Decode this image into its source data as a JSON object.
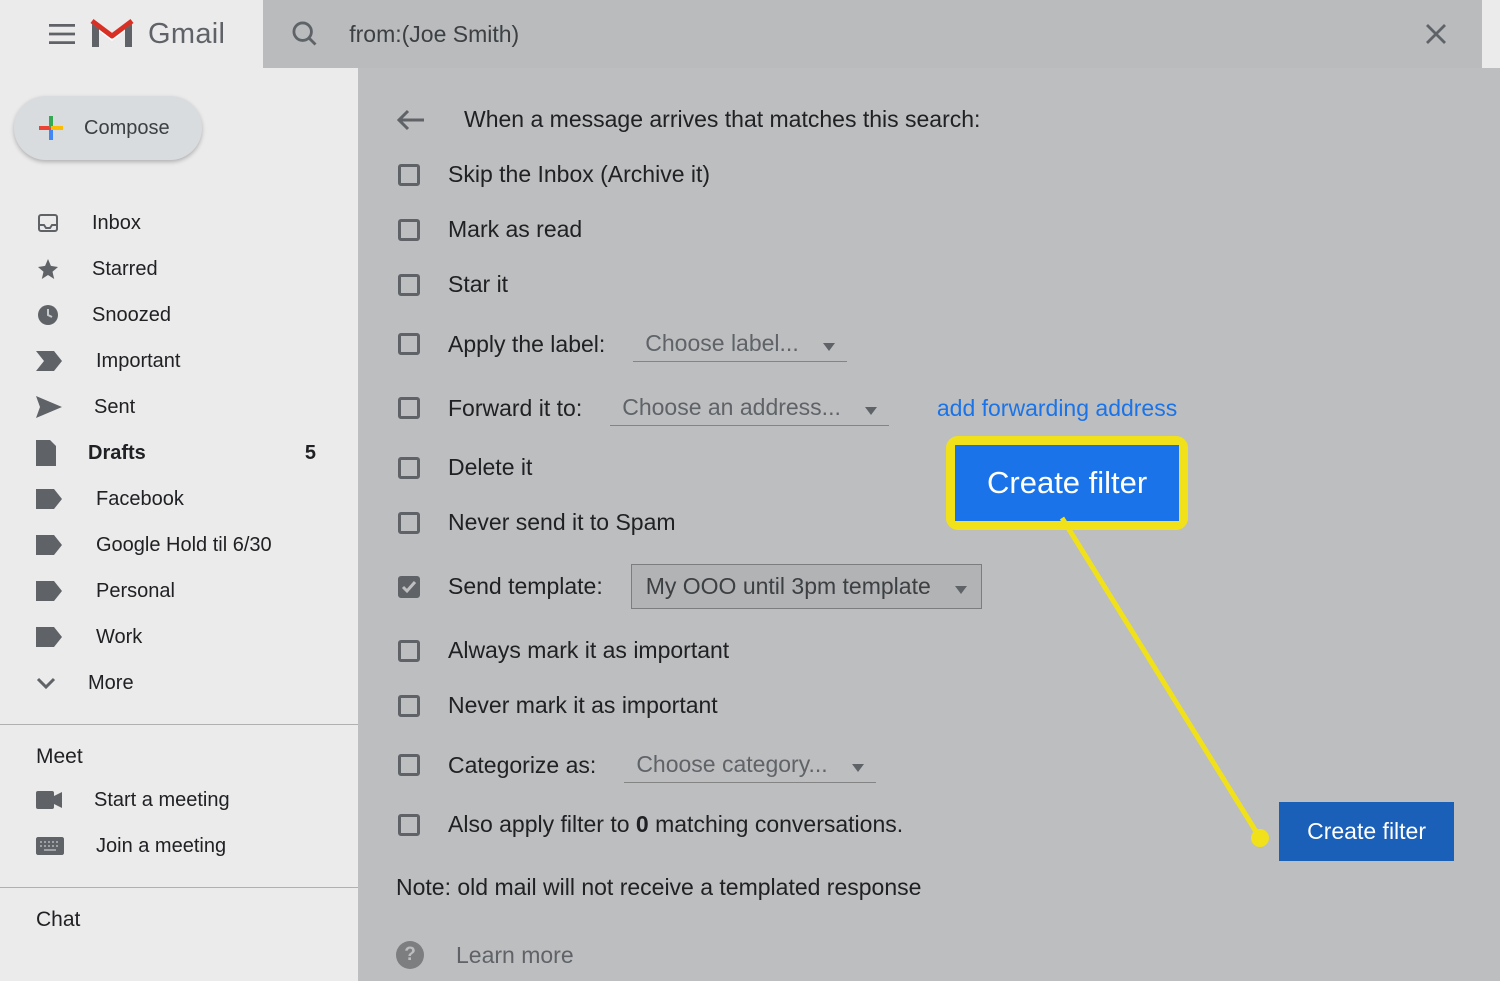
{
  "header": {
    "app_name": "Gmail",
    "search_value": "from:(Joe Smith)"
  },
  "sidebar": {
    "compose_label": "Compose",
    "items": [
      {
        "icon": "inbox-icon",
        "label": "Inbox"
      },
      {
        "icon": "star-icon",
        "label": "Starred"
      },
      {
        "icon": "clock-icon",
        "label": "Snoozed"
      },
      {
        "icon": "important-icon",
        "label": "Important"
      },
      {
        "icon": "sent-icon",
        "label": "Sent"
      },
      {
        "icon": "draft-icon",
        "label": "Drafts",
        "count": "5",
        "bold": true
      },
      {
        "icon": "label-icon",
        "label": "Facebook"
      },
      {
        "icon": "label-icon",
        "label": "Google Hold til 6/30"
      },
      {
        "icon": "label-icon",
        "label": "Personal"
      },
      {
        "icon": "label-icon",
        "label": "Work"
      },
      {
        "icon": "chevron-down-icon",
        "label": "More"
      }
    ],
    "meet_title": "Meet",
    "meet_items": [
      {
        "icon": "camera-icon",
        "label": "Start a meeting"
      },
      {
        "icon": "keyboard-icon",
        "label": "Join a meeting"
      }
    ],
    "chat_title": "Chat"
  },
  "filter": {
    "title": "When a message arrives that matches this search:",
    "options": [
      {
        "label": "Skip the Inbox (Archive it)"
      },
      {
        "label": "Mark as read"
      },
      {
        "label": "Star it"
      },
      {
        "label": "Apply the label:",
        "dropdown": "Choose label..."
      },
      {
        "label": "Forward it to:",
        "dropdown": "Choose an address...",
        "link": "add forwarding address"
      },
      {
        "label": "Delete it"
      },
      {
        "label": "Never send it to Spam"
      },
      {
        "label": "Send template:",
        "dropdown": "My OOO until 3pm template",
        "filled": true,
        "checked": true
      },
      {
        "label": "Always mark it as important"
      },
      {
        "label": "Never mark it as important"
      },
      {
        "label": "Categorize as:",
        "dropdown": "Choose category..."
      },
      {
        "label_html": "Also apply filter to <b>0</b> matching conversations."
      }
    ],
    "note": "Note: old mail will not receive a templated response",
    "learn_more": "Learn more",
    "create_button": "Create filter"
  },
  "callout": {
    "label": "Create filter"
  }
}
